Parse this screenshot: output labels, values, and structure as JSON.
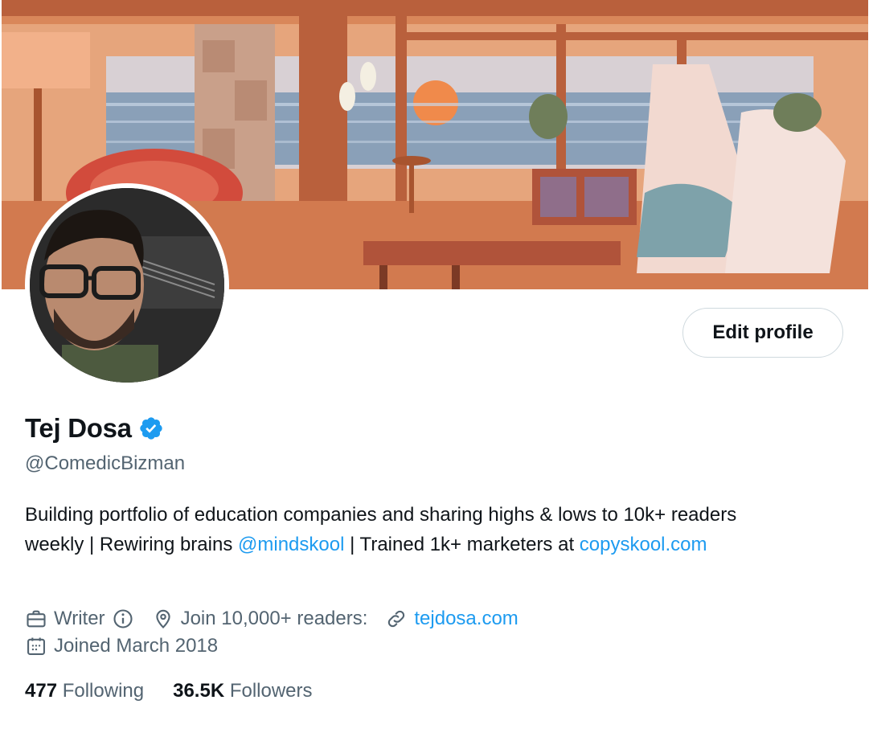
{
  "profile": {
    "name": "Tej Dosa",
    "handle": "@ComedicBizman",
    "edit_label": "Edit profile",
    "bio": {
      "part1": "Building portfolio of education companies and sharing highs & lows to 10k+ readers weekly | Rewiring brains ",
      "mention": "@mindskool",
      "part2": " | Trained 1k+ marketers at ",
      "link": "copyskool.com"
    },
    "meta": {
      "profession": "Writer",
      "location": "Join 10,000+ readers:",
      "website": "tejdosa.com",
      "joined": "Joined March 2018"
    },
    "stats": {
      "following_count": "477",
      "following_label": "Following",
      "followers_count": "36.5K",
      "followers_label": "Followers"
    }
  },
  "icons": {
    "verified": "verified-badge-icon",
    "profession": "briefcase-icon",
    "info": "info-icon",
    "location": "location-pin-icon",
    "website": "link-icon",
    "joined": "calendar-icon"
  },
  "colors": {
    "accent": "#1d9bf0",
    "text_primary": "#0f1419",
    "text_secondary": "#536471",
    "border": "#cfd9de"
  }
}
